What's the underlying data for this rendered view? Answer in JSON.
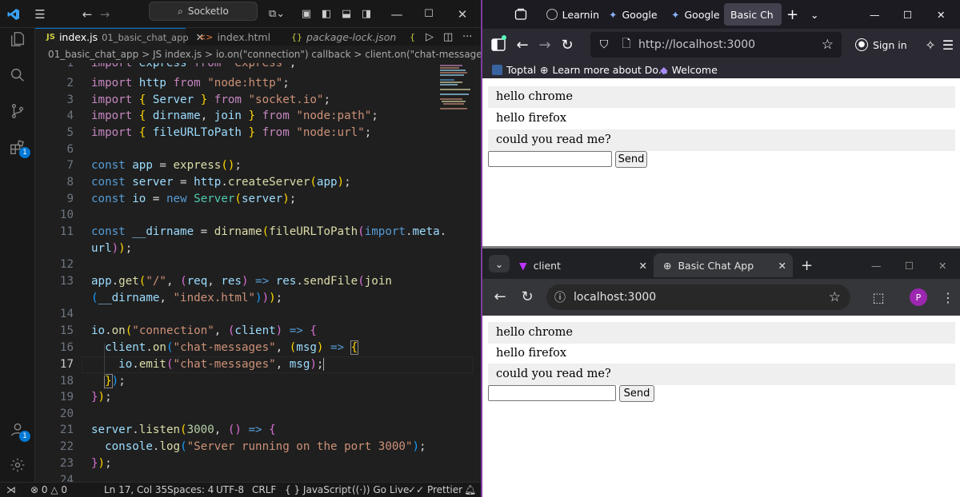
{
  "vscode": {
    "search_text": "SocketIo",
    "tabs": [
      {
        "icon": "JS",
        "name": "index.js",
        "detail": "01_basic_chat_app"
      },
      {
        "icon": "<>",
        "name": "index.html"
      },
      {
        "icon": "{}",
        "name": "package-lock.json"
      },
      {
        "icon": "{"
      }
    ],
    "breadcrumb": "01_basic_chat_app  >  JS index.js  >  io.on(\"connection\") callback  >  client.on(\"chat-messages\") c",
    "badge_extensions": "1",
    "badge_accounts": "1",
    "line_numbers": [
      "1",
      "2",
      "3",
      "4",
      "5",
      "6",
      "7",
      "8",
      "9",
      "10",
      "11",
      "",
      "12",
      "13",
      "",
      "14",
      "15",
      "16",
      "17",
      "18",
      "19",
      "20",
      "21",
      "22",
      "23",
      "24"
    ],
    "current_line": "17",
    "status": {
      "errors": "0",
      "warnings": "0",
      "position": "Ln 17, Col 35",
      "spaces": "Spaces: 4",
      "encoding": "UTF-8",
      "eol": "CRLF",
      "language": "JavaScript",
      "golive": "Go Live",
      "prettier": "Prettier"
    }
  },
  "firefox": {
    "tabs": [
      "Learnin",
      "Google",
      "Google",
      "Basic Ch"
    ],
    "url": "http://localhost:3000",
    "sign_in": "Sign in",
    "bookmarks": [
      "Toptal",
      "Learn more about Do...",
      "Welcome"
    ],
    "messages": [
      "hello chrome",
      "hello firefox",
      "could you read me?"
    ],
    "send_label": "Send",
    "input_value": ""
  },
  "chrome": {
    "tabs": [
      "client",
      "Basic Chat App"
    ],
    "url": "localhost:3000",
    "avatar": "P",
    "messages": [
      "hello chrome",
      "hello firefox",
      "could you read me?"
    ],
    "send_label": "Send",
    "input_value": ""
  }
}
